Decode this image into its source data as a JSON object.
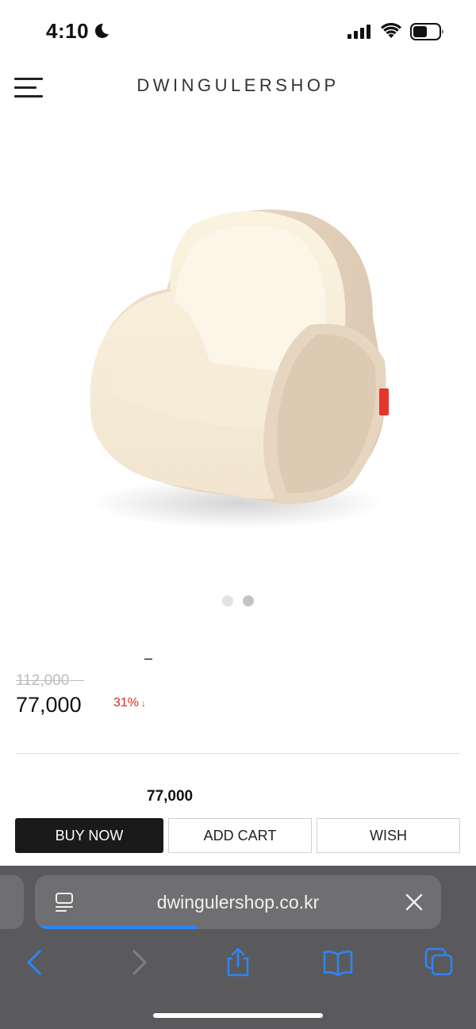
{
  "status_bar": {
    "time": "4:10",
    "focus_icon": "moon-icon",
    "signal_icon": "cellular-signal-icon",
    "wifi_icon": "wifi-icon",
    "battery_icon": "battery-icon",
    "battery_level": 0.55
  },
  "header": {
    "menu_icon": "hamburger-menu-icon",
    "brand": "DWINGULERSHOP"
  },
  "product": {
    "image_alt": "cream kids sofa chair",
    "gallery": {
      "count": 2,
      "active_index": 1
    },
    "dash": "–",
    "original_price": "112,000",
    "sale_price": "77,000",
    "discount_percent": "31%",
    "discount_arrow": "↓",
    "total_price": "77,000"
  },
  "actions": {
    "buy_label": "BUY NOW",
    "cart_label": "ADD CART",
    "wish_label": "WISH"
  },
  "browser": {
    "page_icon": "page-menu-icon",
    "url": "dwingulershop.co.kr",
    "close_icon": "close-icon",
    "load_progress": 0.4,
    "toolbar": [
      "back-icon",
      "forward-icon",
      "share-icon",
      "bookmarks-icon",
      "tabs-icon"
    ]
  },
  "colors": {
    "accent_blue": "#2f84f5",
    "discount_red": "#e0261c",
    "buy_button": "#1a1a1a"
  }
}
